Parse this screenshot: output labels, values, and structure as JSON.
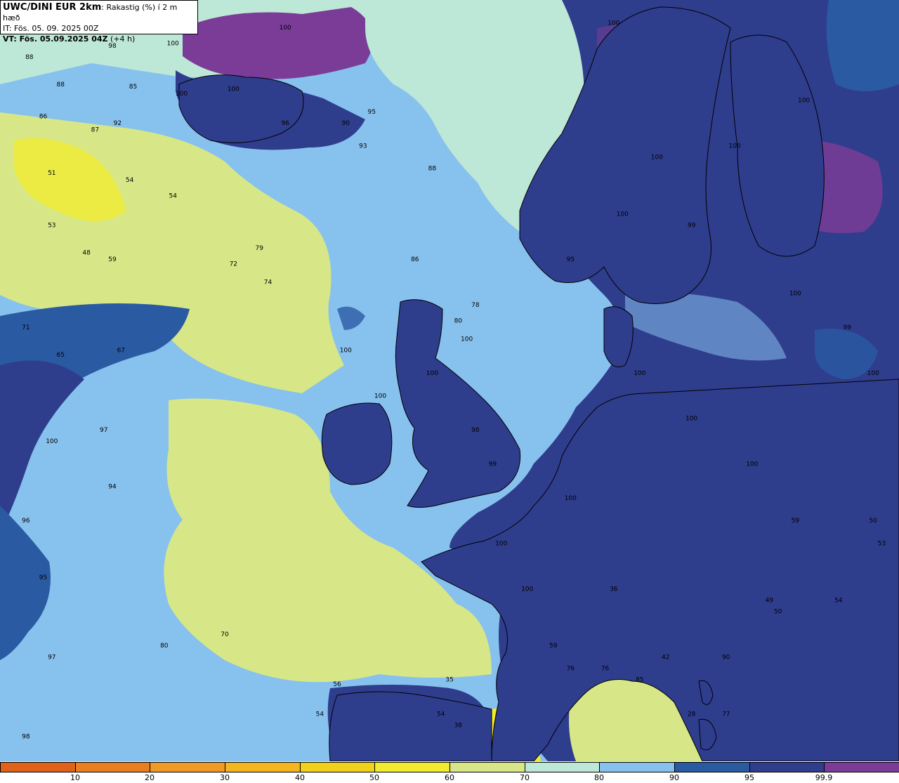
{
  "header": {
    "model": "UWC/DINI EUR 2km",
    "parameter": ": Rakastig (%) í 2 m hæð",
    "it_line": "IT: Fös. 05. 09. 2025 00Z",
    "vt_label": "VT: Fös. 05.09.2025 04Z",
    "vt_offset": " (+4 h)"
  },
  "legend": {
    "colors": [
      "#e0611a",
      "#e97f20",
      "#ef9a25",
      "#f4b51f",
      "#f2d11a",
      "#f3ec2e",
      "#d7e787",
      "#bde7d6",
      "#87c1ee",
      "#2a5aa2",
      "#2f3d8d",
      "#7a3c97"
    ],
    "ticks": [
      "10",
      "20",
      "30",
      "40",
      "50",
      "60",
      "70",
      "80",
      "90",
      "95",
      "99.9"
    ]
  },
  "field_labels": [
    {
      "v": "97",
      "lon": -22.7,
      "lat": 67.6
    },
    {
      "v": "100",
      "lon": -7.5,
      "lat": 67.2
    },
    {
      "v": "100",
      "lon": 11.5,
      "lat": 67.4
    },
    {
      "v": "88",
      "lon": -22.3,
      "lat": 65.9
    },
    {
      "v": "98",
      "lon": -17.5,
      "lat": 66.4
    },
    {
      "v": "100",
      "lon": -14.0,
      "lat": 66.5
    },
    {
      "v": "88",
      "lon": -20.5,
      "lat": 64.7
    },
    {
      "v": "85",
      "lon": -16.3,
      "lat": 64.6
    },
    {
      "v": "100",
      "lon": -13.5,
      "lat": 64.3
    },
    {
      "v": "100",
      "lon": -10.5,
      "lat": 64.5
    },
    {
      "v": "96",
      "lon": -7.5,
      "lat": 63.0
    },
    {
      "v": "90",
      "lon": -4.0,
      "lat": 63.0
    },
    {
      "v": "86",
      "lon": -21.5,
      "lat": 63.3
    },
    {
      "v": "87",
      "lon": -18.5,
      "lat": 62.7
    },
    {
      "v": "92",
      "lon": -17.2,
      "lat": 63.0
    },
    {
      "v": "51",
      "lon": -21.0,
      "lat": 60.8
    },
    {
      "v": "54",
      "lon": -16.5,
      "lat": 60.5
    },
    {
      "v": "54",
      "lon": -14.0,
      "lat": 59.8
    },
    {
      "v": "53",
      "lon": -21.0,
      "lat": 58.5
    },
    {
      "v": "48",
      "lon": -19.0,
      "lat": 57.3
    },
    {
      "v": "59",
      "lon": -17.5,
      "lat": 57.0
    },
    {
      "v": "72",
      "lon": -10.5,
      "lat": 56.8
    },
    {
      "v": "79",
      "lon": -9.0,
      "lat": 57.5
    },
    {
      "v": "74",
      "lon": -8.5,
      "lat": 56.0
    },
    {
      "v": "71",
      "lon": -22.5,
      "lat": 54.0
    },
    {
      "v": "65",
      "lon": -20.5,
      "lat": 52.8
    },
    {
      "v": "67",
      "lon": -17.0,
      "lat": 53.0
    },
    {
      "v": "97",
      "lon": -18.0,
      "lat": 49.5
    },
    {
      "v": "100",
      "lon": -21.0,
      "lat": 49.0
    },
    {
      "v": "94",
      "lon": -17.5,
      "lat": 47.0
    },
    {
      "v": "96",
      "lon": -22.5,
      "lat": 45.5
    },
    {
      "v": "95",
      "lon": -21.5,
      "lat": 43.0
    },
    {
      "v": "97",
      "lon": -21.0,
      "lat": 39.5
    },
    {
      "v": "98",
      "lon": -22.5,
      "lat": 36.0
    },
    {
      "v": "80",
      "lon": -14.5,
      "lat": 40.0
    },
    {
      "v": "70",
      "lon": -11.0,
      "lat": 40.5
    },
    {
      "v": "56",
      "lon": -4.5,
      "lat": 38.3
    },
    {
      "v": "54",
      "lon": -5.5,
      "lat": 37.0
    },
    {
      "v": "76",
      "lon": -0.5,
      "lat": 35.0
    },
    {
      "v": "100",
      "lon": 3.0,
      "lat": 53.5
    },
    {
      "v": "100",
      "lon": 1.0,
      "lat": 52.0
    },
    {
      "v": "100",
      "lon": -2.0,
      "lat": 51.0
    },
    {
      "v": "100",
      "lon": -4.0,
      "lat": 53.0
    },
    {
      "v": "98",
      "lon": 3.5,
      "lat": 49.5
    },
    {
      "v": "99",
      "lon": 4.5,
      "lat": 48.0
    },
    {
      "v": "100",
      "lon": 5.0,
      "lat": 44.5
    },
    {
      "v": "100",
      "lon": 6.5,
      "lat": 42.5
    },
    {
      "v": "100",
      "lon": 9.0,
      "lat": 46.5
    },
    {
      "v": "100",
      "lon": 13.0,
      "lat": 52.0
    },
    {
      "v": "100",
      "lon": 16.0,
      "lat": 50.0
    },
    {
      "v": "100",
      "lon": 19.5,
      "lat": 48.0
    },
    {
      "v": "100",
      "lon": 22.0,
      "lat": 55.5
    },
    {
      "v": "99",
      "lon": 25.0,
      "lat": 54.0
    },
    {
      "v": "100",
      "lon": 26.5,
      "lat": 52.0
    },
    {
      "v": "100",
      "lon": 18.5,
      "lat": 62.0
    },
    {
      "v": "100",
      "lon": 22.5,
      "lat": 64.0
    },
    {
      "v": "100",
      "lon": 14.0,
      "lat": 61.5
    },
    {
      "v": "99",
      "lon": 16.0,
      "lat": 58.5
    },
    {
      "v": "100",
      "lon": 12.0,
      "lat": 59.0
    },
    {
      "v": "95",
      "lon": 9.0,
      "lat": 57.0
    },
    {
      "v": "78",
      "lon": 3.5,
      "lat": 55.0
    },
    {
      "v": "80",
      "lon": 2.5,
      "lat": 54.3
    },
    {
      "v": "86",
      "lon": 0.0,
      "lat": 57.0
    },
    {
      "v": "88",
      "lon": 1.0,
      "lat": 61.0
    },
    {
      "v": "95",
      "lon": -2.5,
      "lat": 63.5
    },
    {
      "v": "93",
      "lon": -3.0,
      "lat": 62.0
    },
    {
      "v": "50",
      "lon": 26.5,
      "lat": 45.5
    },
    {
      "v": "53",
      "lon": 27.0,
      "lat": 44.5
    },
    {
      "v": "59",
      "lon": 22.0,
      "lat": 45.5
    },
    {
      "v": "49",
      "lon": 20.5,
      "lat": 42.0
    },
    {
      "v": "54",
      "lon": 24.5,
      "lat": 42.0
    },
    {
      "v": "50",
      "lon": 21.0,
      "lat": 41.5
    },
    {
      "v": "36",
      "lon": 11.5,
      "lat": 42.5
    },
    {
      "v": "42",
      "lon": 14.5,
      "lat": 39.5
    },
    {
      "v": "35",
      "lon": 2.0,
      "lat": 38.5
    },
    {
      "v": "38",
      "lon": 2.5,
      "lat": 36.5
    },
    {
      "v": "28",
      "lon": 16.0,
      "lat": 37.0
    },
    {
      "v": "54",
      "lon": 1.5,
      "lat": 37.0
    },
    {
      "v": "59",
      "lon": 8.0,
      "lat": 40.0
    },
    {
      "v": "76",
      "lon": 9.0,
      "lat": 39.0
    },
    {
      "v": "76",
      "lon": 11.0,
      "lat": 39.0
    },
    {
      "v": "85",
      "lon": 13.0,
      "lat": 38.5
    },
    {
      "v": "90",
      "lon": 18.0,
      "lat": 39.5
    },
    {
      "v": "77",
      "lon": 18.0,
      "lat": 37.0
    }
  ]
}
